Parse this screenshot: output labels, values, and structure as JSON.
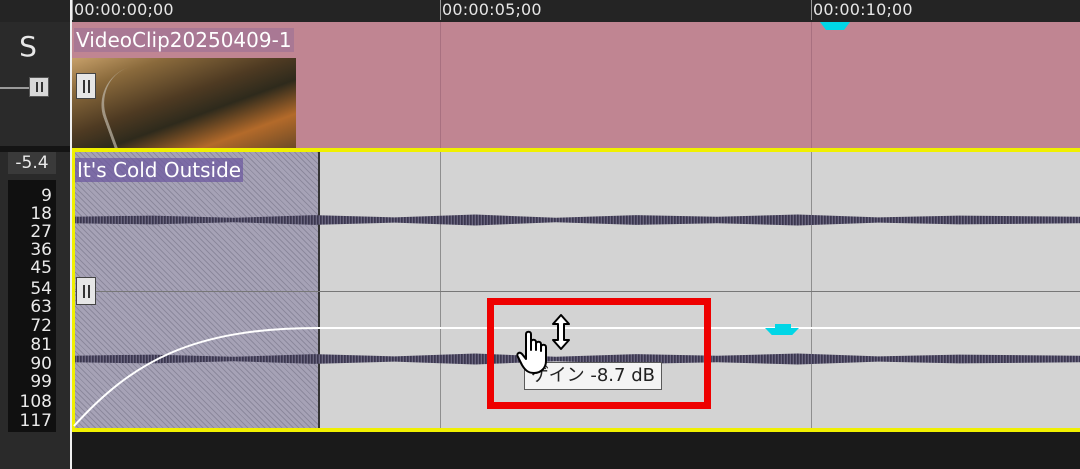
{
  "ruler": {
    "ticks": [
      "00:00:00;00",
      "00:00:05;00",
      "00:00:10;00"
    ]
  },
  "track_header": {
    "solo_label": "S",
    "db_readout": "-5.4",
    "meter_scale": [
      "9",
      "18",
      "27",
      "36",
      "45",
      "54",
      "63",
      "72",
      "81",
      "90",
      "99",
      "108",
      "117"
    ]
  },
  "video_track": {
    "clip_title": "VideoClip20250409-1"
  },
  "audio_track": {
    "clip_title": "It's Cold Outside",
    "tooltip": "ゲイン -8.7 dB"
  },
  "colors": {
    "video_clip": "#c08592",
    "audio_clip": "#d3d3d3",
    "selection": "#f0f000",
    "marker": "#00d6e6",
    "highlight": "#ee0000"
  },
  "icons": [
    "pause-handle-icon",
    "resize-vertical-cursor-icon",
    "hand-cursor-icon"
  ]
}
